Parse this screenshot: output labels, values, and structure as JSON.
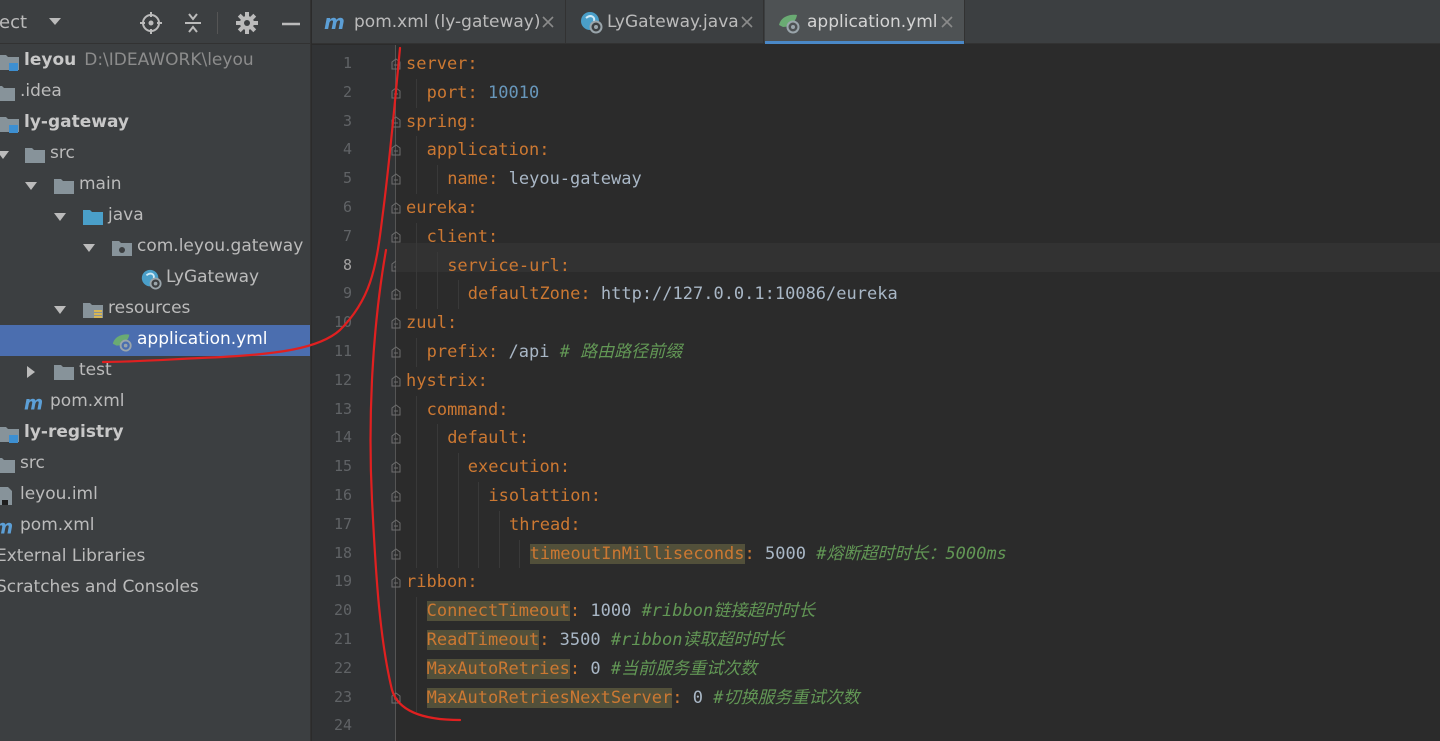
{
  "project_panel": {
    "title": "ject",
    "tree": [
      {
        "label": "leyou",
        "path": "D:\\IDEAWORK\\leyou",
        "bold": true,
        "icon": "module-folder-icon"
      },
      {
        "label": ".idea",
        "icon": "folder-icon"
      },
      {
        "label": "ly-gateway",
        "bold": true,
        "icon": "module-folder-icon"
      },
      {
        "label": "src",
        "icon": "folder-icon"
      },
      {
        "label": "main",
        "icon": "folder-icon"
      },
      {
        "label": "java",
        "icon": "source-folder-icon"
      },
      {
        "label": "com.leyou.gateway",
        "icon": "package-icon"
      },
      {
        "label": "LyGateway",
        "icon": "spring-class-icon"
      },
      {
        "label": "resources",
        "icon": "resources-folder-icon"
      },
      {
        "label": "application.yml",
        "icon": "spring-yml-icon",
        "selected": true
      },
      {
        "label": "test",
        "icon": "folder-icon"
      },
      {
        "label": "pom.xml",
        "icon": "maven-icon"
      },
      {
        "label": "ly-registry",
        "bold": true,
        "icon": "module-folder-icon"
      },
      {
        "label": "src",
        "icon": "folder-icon"
      },
      {
        "label": "leyou.iml",
        "icon": "iml-file-icon"
      },
      {
        "label": "pom.xml",
        "icon": "maven-icon"
      },
      {
        "label": "External Libraries",
        "icon": "libraries-icon"
      },
      {
        "label": "Scratches and Consoles",
        "icon": "scratches-icon"
      }
    ]
  },
  "tabs": [
    {
      "label": "pom.xml (ly-gateway)",
      "icon": "maven-icon",
      "active": false
    },
    {
      "label": "LyGateway.java",
      "icon": "spring-class-icon",
      "active": false
    },
    {
      "label": "application.yml",
      "icon": "spring-yml-icon",
      "active": true
    }
  ],
  "editor": {
    "current_line": 8,
    "line_numbers": [
      "1",
      "2",
      "3",
      "4",
      "5",
      "6",
      "7",
      "8",
      "9",
      "10",
      "11",
      "12",
      "13",
      "14",
      "15",
      "16",
      "17",
      "18",
      "19",
      "20",
      "21",
      "22",
      "23",
      "24"
    ],
    "lines": [
      {
        "key": "server",
        "colon": ":"
      },
      {
        "key": "port",
        "colon": ": ",
        "num": "10010"
      },
      {
        "key": "spring",
        "colon": ":"
      },
      {
        "key": "application",
        "colon": ":"
      },
      {
        "key": "name",
        "colon": ": ",
        "val": "leyou-gateway"
      },
      {
        "key": "eureka",
        "colon": ":"
      },
      {
        "key": "client",
        "colon": ":"
      },
      {
        "key": "service-url",
        "colon": ":"
      },
      {
        "key": "defaultZone",
        "colon": ": ",
        "val": "http://127.0.0.1:10086/eureka"
      },
      {
        "key": "zuul",
        "colon": ":"
      },
      {
        "key": "prefix",
        "colon": ": ",
        "val": "/api ",
        "comment": "# 路由路径前缀"
      },
      {
        "key": "hystrix",
        "colon": ":"
      },
      {
        "key": "command",
        "colon": ":"
      },
      {
        "key": "default",
        "colon": ":"
      },
      {
        "key": "execution",
        "colon": ":"
      },
      {
        "key": "isolattion",
        "colon": ":"
      },
      {
        "key": "thread",
        "colon": ":"
      },
      {
        "key": "timeoutInMilliseconds",
        "colon": ": ",
        "val": "5000 ",
        "comment": "#熔断超时时长：5000ms"
      },
      {
        "key": "ribbon",
        "colon": ":"
      },
      {
        "key": "ConnectTimeout",
        "colon": ": ",
        "val": "1000 ",
        "comment": "#ribbon链接超时时长"
      },
      {
        "key": "ReadTimeout",
        "colon": ": ",
        "val": "3500 ",
        "comment": "#ribbon读取超时时长"
      },
      {
        "key": "MaxAutoRetries",
        "colon": ": ",
        "val": "0 ",
        "comment": "#当前服务重试次数"
      },
      {
        "key": "MaxAutoRetriesNextServer",
        "colon": ": ",
        "val": "0 ",
        "comment": "#切换服务重试次数"
      },
      {
        "key": "",
        "colon": ""
      }
    ]
  },
  "colors": {
    "key": "#cc7832",
    "comment": "#629755",
    "number": "#6897bb",
    "selection": "#4b6eaf",
    "annotation": "#e02020"
  }
}
